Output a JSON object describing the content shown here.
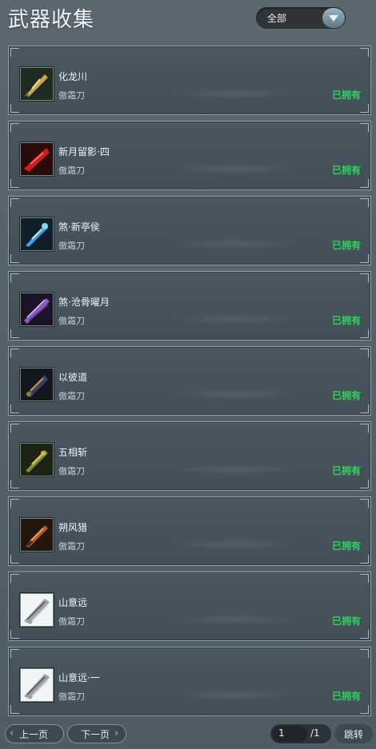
{
  "header": {
    "title": "武器收集",
    "filter_selected": "全部"
  },
  "items": [
    {
      "name": "化龙川",
      "type": "傲霜刀",
      "status": "已拥有",
      "icon": "golden-blade-icon"
    },
    {
      "name": "新月留影·四",
      "type": "傲霜刀",
      "status": "已拥有",
      "icon": "crimson-blade-icon"
    },
    {
      "name": "煞·新亭侯",
      "type": "傲霜刀",
      "status": "已拥有",
      "icon": "ice-blade-icon"
    },
    {
      "name": "煞·沧骨曜月",
      "type": "傲霜刀",
      "status": "已拥有",
      "icon": "violet-blade-icon"
    },
    {
      "name": "以彼道",
      "type": "傲霜刀",
      "status": "已拥有",
      "icon": "dark-blade-icon"
    },
    {
      "name": "五相斩",
      "type": "傲霜刀",
      "status": "已拥有",
      "icon": "jade-blade-icon"
    },
    {
      "name": "朔风猎",
      "type": "傲霜刀",
      "status": "已拥有",
      "icon": "flame-blade-icon"
    },
    {
      "name": "山意远",
      "type": "傲霜刀",
      "status": "已拥有",
      "icon": "silver-blade-icon"
    },
    {
      "name": "山意远·一",
      "type": "傲霜刀",
      "status": "已拥有",
      "icon": "silver-blade-icon"
    }
  ],
  "pager": {
    "prev_label": "上一页",
    "next_label": "下一页",
    "current_page": "1",
    "total_pages": "/1",
    "jump_label": "跳转"
  },
  "colors": {
    "owned_status": "#2fd25a",
    "card_border": "#8ea0aa"
  }
}
